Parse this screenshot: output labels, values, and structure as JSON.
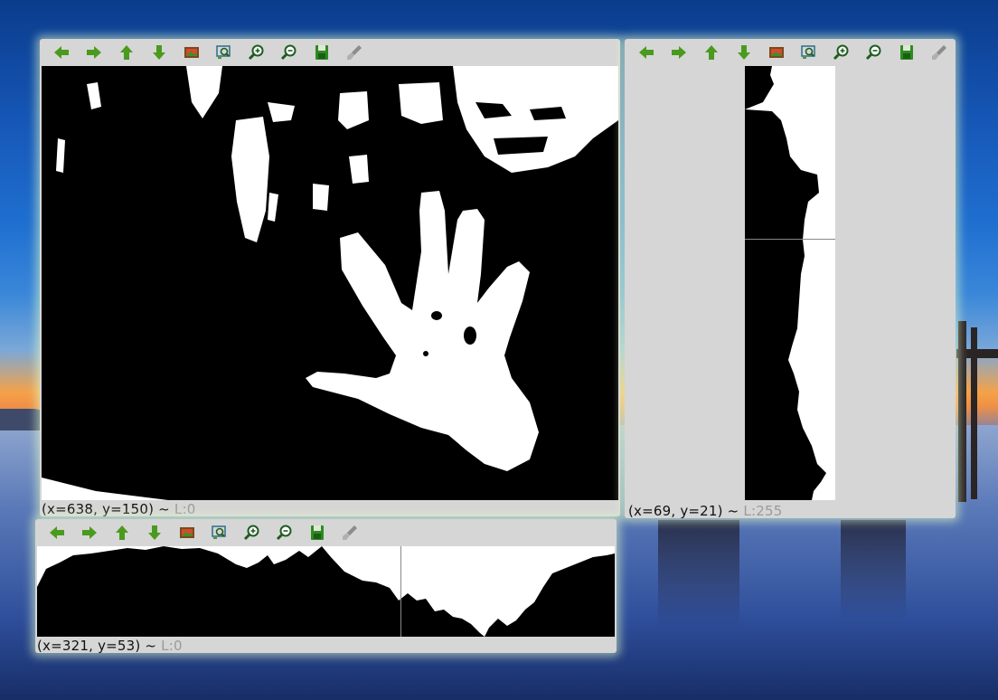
{
  "toolbar": {
    "buttons": [
      {
        "name": "pan-left-button",
        "icon": "arrow-left-icon",
        "label": "Pan left"
      },
      {
        "name": "pan-right-button",
        "icon": "arrow-right-icon",
        "label": "Pan right"
      },
      {
        "name": "pan-up-button",
        "icon": "arrow-up-icon",
        "label": "Pan up"
      },
      {
        "name": "pan-down-button",
        "icon": "arrow-down-icon",
        "label": "Pan down"
      },
      {
        "name": "fit-image-button",
        "icon": "image-icon",
        "label": "Fit image"
      },
      {
        "name": "zoom-region-button",
        "icon": "zoom-region-icon",
        "label": "Zoom region"
      },
      {
        "name": "zoom-in-button",
        "icon": "zoom-in-icon",
        "label": "Zoom in"
      },
      {
        "name": "zoom-out-button",
        "icon": "zoom-out-icon",
        "label": "Zoom out"
      },
      {
        "name": "save-button",
        "icon": "save-icon",
        "label": "Save"
      },
      {
        "name": "properties-button",
        "icon": "brush-icon",
        "label": "Properties"
      }
    ]
  },
  "colors": {
    "arrow_green": "#4a9a1e",
    "window_bg": "#d6d6d6",
    "glow": "#eaffc8"
  },
  "main_window": {
    "status_coords": "(x=638, y=150) ~",
    "status_value": " L:0"
  },
  "vertical_projection_window": {
    "status_coords": "(x=69, y=21) ~",
    "status_value": " L:255"
  },
  "horizontal_projection_window": {
    "status_coords": "(x=321, y=53) ~",
    "status_value": " L:0"
  }
}
